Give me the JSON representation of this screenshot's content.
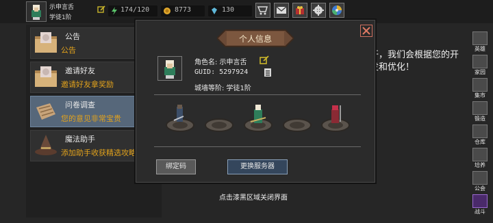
{
  "player": {
    "name": "示申言舌",
    "rank": "学徒1阶"
  },
  "resources": {
    "energy": "174/120",
    "gold": "8773",
    "gems": "130"
  },
  "top_buttons": [
    {
      "icon": "shop-cart-icon"
    },
    {
      "icon": "mail-icon"
    },
    {
      "icon": "gift-box-icon"
    },
    {
      "icon": "settings-gear-icon"
    },
    {
      "icon": "swirl-icon"
    }
  ],
  "menu": {
    "items": [
      {
        "title": "公告",
        "desc": "公告",
        "icon": "scroll-icon"
      },
      {
        "title": "邀请好友",
        "desc": "邀请好友拿奖励",
        "icon": "scroll-icon"
      },
      {
        "title": "问卷调查",
        "desc": "您的意见非常宝贵",
        "icon": "survey-icon"
      },
      {
        "title": "魔法助手",
        "desc": "添加助手收获精选攻略",
        "icon": "wizard-hat-icon"
      }
    ]
  },
  "background": {
    "text": "开，我们会根据您的开发和优化！",
    "close_hint": "点击漆黑区域关闭界面"
  },
  "sidebar": {
    "items": [
      {
        "label": "英雄",
        "icon": "hero-icon"
      },
      {
        "label": "家园",
        "icon": "home-icon"
      },
      {
        "label": "集市",
        "icon": "market-icon"
      },
      {
        "label": "锻造",
        "icon": "forge-icon"
      },
      {
        "label": "仓库",
        "icon": "warehouse-icon"
      },
      {
        "label": "培养",
        "icon": "train-icon"
      },
      {
        "label": "公会",
        "icon": "guild-icon"
      },
      {
        "label": "战斗",
        "icon": "battle-icon"
      }
    ]
  },
  "modal": {
    "title": "个人信息",
    "name_label": "角色名: 示申言舌",
    "guid_label": "GUID: 5297924",
    "rank_label": "城墙等阶: 学徒1阶",
    "bind_button": "绑定码",
    "switch_button": "更换服务器"
  },
  "colors": {
    "accent_orange": "#e2a21c",
    "active_item": "#56677a",
    "background": "#262626"
  }
}
